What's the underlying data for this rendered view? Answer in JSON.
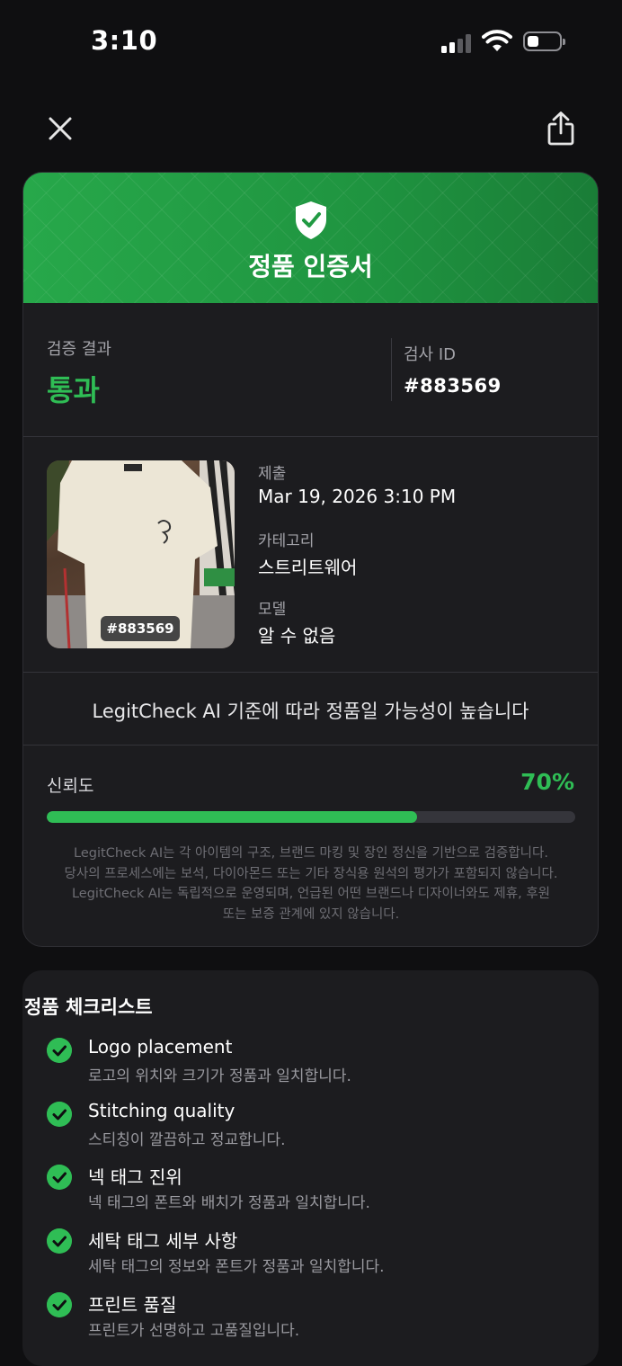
{
  "status_bar": {
    "time": "3:10"
  },
  "certificate": {
    "title": "정품 인증서",
    "result_label": "검증 결과",
    "result_value": "통과",
    "inspection_id_label": "검사 ID",
    "inspection_id": "#883569",
    "photo_badge": "#883569",
    "submitted_label": "제출",
    "submitted_value": "Mar 19, 2026 3:10 PM",
    "category_label": "카테고리",
    "category_value": "스트리트웨어",
    "model_label": "모델",
    "model_value": "알 수 없음",
    "ai_statement": "LegitCheck AI 기준에 따라 정품일 가능성이 높습니다",
    "confidence_label": "신뢰도",
    "confidence_value": "70%",
    "confidence_fraction": 0.7,
    "disclaimer": [
      "LegitCheck AI는 각 아이템의 구조, 브랜드 마킹 및 장인 정신을 기반으로 검증합니다.",
      "당사의 프로세스에는 보석, 다이아몬드 또는 기타 장식용 원석의 평가가 포함되지 않습니다.",
      "LegitCheck AI는 독립적으로 운영되며, 언급된 어떤 브랜드나 디자이너와도 제휴, 후원",
      "또는 보증 관계에 있지 않습니다."
    ]
  },
  "checklist": {
    "title": "정품 체크리스트",
    "items": [
      {
        "name": "Logo placement",
        "desc": "로고의 위치와 크기가 정품과 일치합니다."
      },
      {
        "name": "Stitching quality",
        "desc": "스티칭이 깔끔하고 정교합니다."
      },
      {
        "name": "넥 태그 진위",
        "desc": "넥 태그의 폰트와 배치가 정품과 일치합니다."
      },
      {
        "name": "세탁 태그 세부 사항",
        "desc": "세탁 태그의 정보와 폰트가 정품과 일치합니다."
      },
      {
        "name": "프린트 품질",
        "desc": "프린트가 선명하고 고품질입니다."
      }
    ]
  },
  "colors": {
    "accent": "#2fbd55",
    "header_green": "#219a43",
    "background": "#0f0f11",
    "card": "#1c1c1f"
  },
  "icons": [
    "close-icon",
    "share-icon",
    "shield-check-icon",
    "checkmark-icon",
    "wifi-icon",
    "battery-icon",
    "signal-icon"
  ]
}
